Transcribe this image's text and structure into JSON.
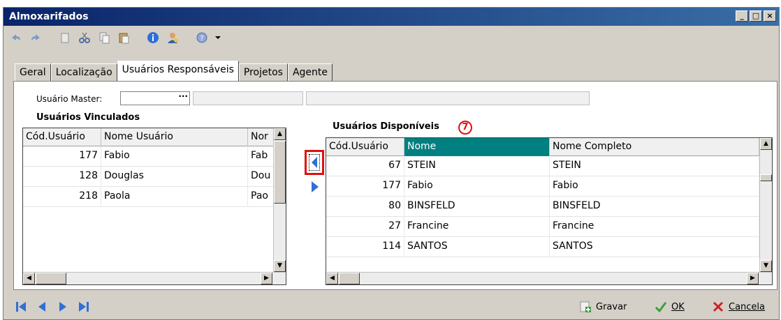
{
  "window": {
    "title": "Almoxarifados"
  },
  "tabs": [
    {
      "label": "Geral"
    },
    {
      "label": "Localização"
    },
    {
      "label": "Usuários Responsáveis"
    },
    {
      "label": "Projetos"
    },
    {
      "label": "Agente"
    }
  ],
  "master": {
    "label": "Usuário Master:",
    "browse": "···"
  },
  "linked": {
    "title": "Usuários Vinculados",
    "columns": [
      "Cód.Usuário",
      "Nome Usuário",
      "Nor"
    ],
    "rows": [
      {
        "code": "177",
        "name": "Fabio",
        "full": "Fab"
      },
      {
        "code": "128",
        "name": "Douglas",
        "full": "Dou"
      },
      {
        "code": "218",
        "name": "Paola",
        "full": "Pao"
      }
    ]
  },
  "available": {
    "title": "Usuários Disponíveis",
    "step_badge": "7",
    "columns": [
      "Cód.Usuário",
      "Nome",
      "Nome Completo"
    ],
    "rows": [
      {
        "code": "67",
        "name": "STEIN",
        "full": "STEIN"
      },
      {
        "code": "177",
        "name": "Fabio",
        "full": "Fabio"
      },
      {
        "code": "80",
        "name": "BINSFELD",
        "full": "BINSFELD"
      },
      {
        "code": "27",
        "name": "Francine",
        "full": "Francine"
      },
      {
        "code": "114",
        "name": "SANTOS",
        "full": "SANTOS"
      }
    ]
  },
  "actions": {
    "save": "Gravar",
    "ok": "OK",
    "cancel": "Cancela"
  },
  "colors": {
    "accent": "#008080",
    "title": "#0a246a",
    "highlight": "#e01010"
  }
}
